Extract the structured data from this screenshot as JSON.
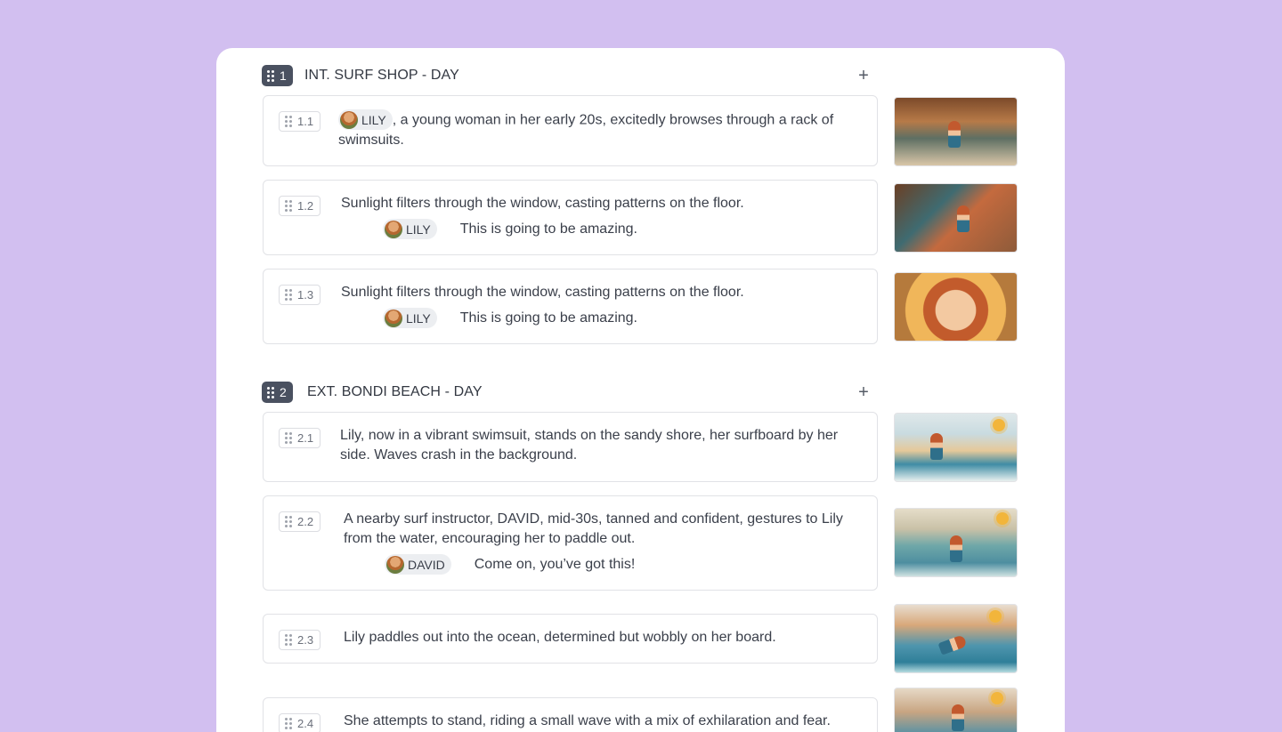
{
  "scenes": [
    {
      "number": "1",
      "title": "INT. SURF SHOP - DAY",
      "add_label": "+",
      "shots": [
        {
          "id": "1.1",
          "character": "LILY",
          "text": ", a young woman in her early 20s, excitedly browses through a rack of swimsuits.",
          "thumb": "surf-shop-browsing"
        },
        {
          "id": "1.2",
          "text": "Sunlight filters through the window, casting patterns on the floor.",
          "dialogue": {
            "character": "LILY",
            "line": "This is going to be amazing."
          },
          "thumb": "surf-shop-lily"
        },
        {
          "id": "1.3",
          "text": "Sunlight filters through the window, casting patterns on the floor.",
          "dialogue": {
            "character": "LILY",
            "line": "This is going to be amazing."
          },
          "thumb": "lily-closeup"
        }
      ]
    },
    {
      "number": "2",
      "title": "EXT. BONDI BEACH - DAY",
      "add_label": "+",
      "shots": [
        {
          "id": "2.1",
          "text": "Lily, now in a vibrant swimsuit, stands on the sandy shore, her surfboard by her side. Waves crash in the background.",
          "thumb": "beach-shore"
        },
        {
          "id": "2.2",
          "text": "A nearby surf instructor, DAVID, mid-30s, tanned and confident, gestures to Lily from the water, encouraging her to paddle out.",
          "dialogue": {
            "character": "DAVID",
            "line": "Come on, you’ve got this!"
          },
          "thumb": "david-in-water"
        },
        {
          "id": "2.3",
          "text": "Lily paddles out into the ocean, determined but wobbly on her board.",
          "thumb": "lily-paddling"
        },
        {
          "id": "2.4",
          "text": "She attempts to stand, riding a small wave with a mix of exhilaration and fear.",
          "thumb": "lily-riding-wave"
        }
      ]
    }
  ],
  "colors": {
    "background": "#d2bff0",
    "panel": "#ffffff",
    "scene_badge": "#4a5160",
    "chip": "#eceef1"
  }
}
